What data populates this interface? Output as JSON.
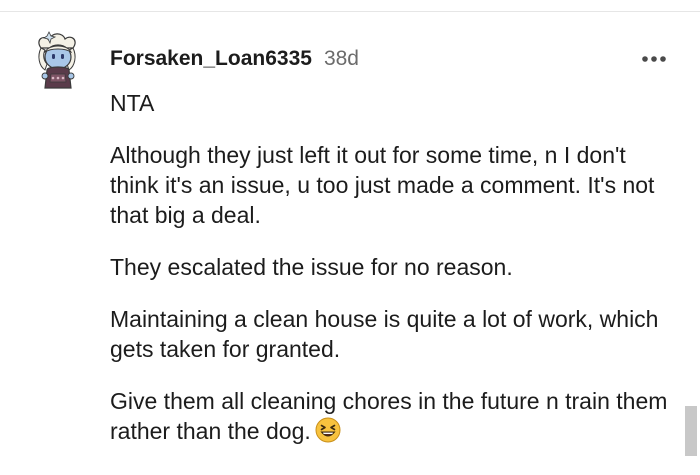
{
  "comment": {
    "username": "Forsaken_Loan6335",
    "age": "38d",
    "more_icon": "ellipsis-icon",
    "avatar_icon": "snoo-avatar",
    "paragraphs": [
      "NTA",
      "Although they just left it out for some time, n I don't think it's an issue, u too just made a comment. It's not that big a deal.",
      "They escalated the issue for no reason.",
      "Maintaining a clean house is quite a lot of work, which gets taken for granted.",
      "Give them all cleaning chores in the future n train them rather than the dog."
    ],
    "emoji": "grinning-squinting-face"
  },
  "colors": {
    "text": "#1c1c1c",
    "muted": "#6b6b6b",
    "divider": "#e6e6e6",
    "scrollbar": "#c8c8c8",
    "emoji_yellow": "#f7c23e"
  }
}
